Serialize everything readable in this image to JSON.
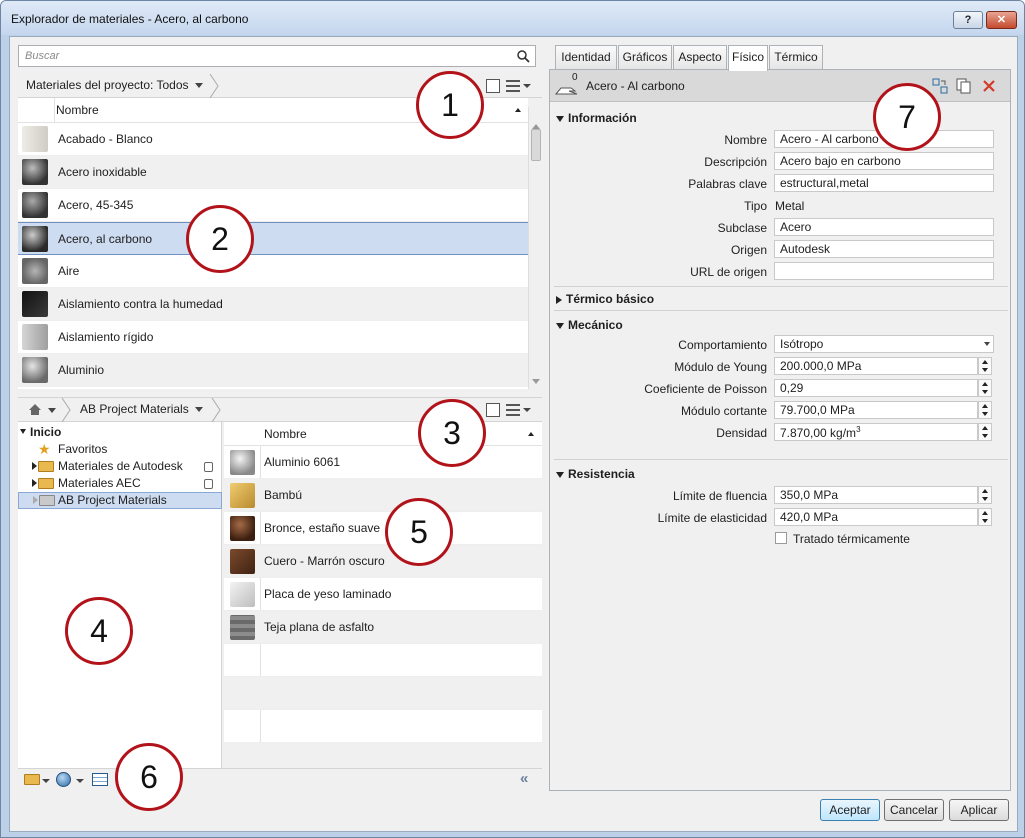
{
  "window": {
    "title": "Explorador de materiales - Acero, al carbono",
    "help_label": "?",
    "close_label": "✕"
  },
  "search": {
    "placeholder": "Buscar"
  },
  "project_bar": {
    "breadcrumb": "Materiales del proyecto: Todos"
  },
  "project_list": {
    "column_header": "Nombre",
    "rows": [
      {
        "name": "Acabado - Blanco",
        "color": "#d9d6cf"
      },
      {
        "name": "Acero inoxidable",
        "color": "#6b6b6b"
      },
      {
        "name": "Acero, 45-345",
        "color": "#777777"
      },
      {
        "name": "Acero, al carbono",
        "color": "#555555"
      },
      {
        "name": "Aire",
        "color": "#9a9a9a"
      },
      {
        "name": "Aislamiento contra la humedad",
        "color": "#2a2a2a"
      },
      {
        "name": "Aislamiento rígido",
        "color": "#b9b9b9"
      },
      {
        "name": "Aluminio",
        "color": "#8d8d8d"
      }
    ],
    "selected_index": 3
  },
  "library_bar": {
    "breadcrumb": "AB Project Materials"
  },
  "tree": {
    "root": "Inicio",
    "items": [
      {
        "label": "Favoritos",
        "icon": "star-icon"
      },
      {
        "label": "Materiales de Autodesk",
        "icon": "folder-icon",
        "locked": true
      },
      {
        "label": "Materiales AEC",
        "icon": "folder-icon",
        "locked": true
      },
      {
        "label": "AB Project Materials",
        "icon": "folder-icon",
        "selected": true
      }
    ]
  },
  "library_list": {
    "column_header": "Nombre",
    "rows": [
      {
        "name": "Aluminio 6061",
        "color": "#a8a8a8"
      },
      {
        "name": "Bambú",
        "color": "#d9b35c"
      },
      {
        "name": "Bronce, estaño suave",
        "color": "#6b3f28"
      },
      {
        "name": "Cuero - Marrón oscuro",
        "color": "#5c3520"
      },
      {
        "name": "Placa de yeso laminado",
        "color": "#dcdcdc"
      },
      {
        "name": "Teja plana de asfalto",
        "color": "#7a7a7a"
      }
    ]
  },
  "tabs": [
    {
      "label": "Identidad"
    },
    {
      "label": "Gráficos"
    },
    {
      "label": "Aspecto"
    },
    {
      "label": "Físico",
      "active": true
    },
    {
      "label": "Térmico"
    }
  ],
  "asset": {
    "name": "Acero - Al carbono",
    "badge": "0"
  },
  "info": {
    "section": "Información",
    "nombre_label": "Nombre",
    "nombre": "Acero - Al carbono",
    "descripcion_label": "Descripción",
    "descripcion": "Acero bajo en carbono",
    "palabras_label": "Palabras clave",
    "palabras": "estructural,metal",
    "tipo_label": "Tipo",
    "tipo": "Metal",
    "subclase_label": "Subclase",
    "subclase": "Acero",
    "origen_label": "Origen",
    "origen": "Autodesk",
    "url_label": "URL de origen",
    "url": ""
  },
  "termico": {
    "section": "Térmico básico"
  },
  "mecanico": {
    "section": "Mecánico",
    "comportamiento_label": "Comportamiento",
    "comportamiento": "Isótropo",
    "young_label": "Módulo de Young",
    "young": "200.000,0 MPa",
    "poisson_label": "Coeficiente de Poisson",
    "poisson": "0,29",
    "cortante_label": "Módulo cortante",
    "cortante": "79.700,0 MPa",
    "densidad_label": "Densidad",
    "densidad": "7.870,00 kg/m",
    "densidad_sup": "3"
  },
  "resistencia": {
    "section": "Resistencia",
    "fluencia_label": "Límite de fluencia",
    "fluencia": "350,0 MPa",
    "elasticidad_label": "Límite de elasticidad",
    "elasticidad": "420,0 MPa",
    "tratado_label": "Tratado térmicamente"
  },
  "buttons": {
    "ok": "Aceptar",
    "cancel": "Cancelar",
    "apply": "Aplicar"
  },
  "callouts": [
    "1",
    "2",
    "3",
    "4",
    "5",
    "6",
    "7"
  ]
}
